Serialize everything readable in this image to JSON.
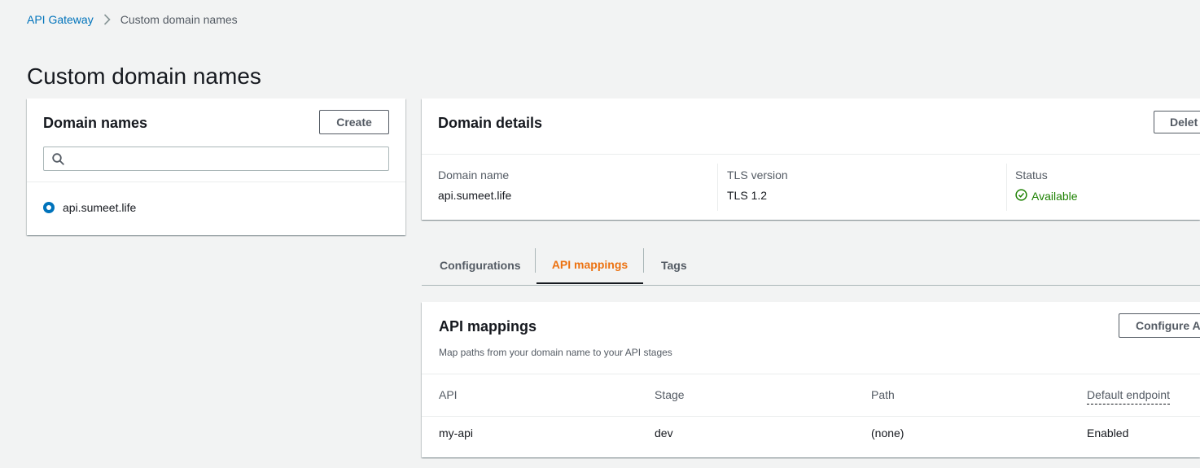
{
  "breadcrumb": {
    "root": "API Gateway",
    "current": "Custom domain names"
  },
  "page_title": "Custom domain names",
  "left_panel": {
    "title": "Domain names",
    "create_label": "Create",
    "search": {
      "value": "",
      "placeholder": ""
    },
    "items": [
      {
        "label": "api.sumeet.life",
        "selected": true
      }
    ]
  },
  "details": {
    "title": "Domain details",
    "delete_label": "Delet",
    "fields": {
      "domain_name_label": "Domain name",
      "domain_name_value": "api.sumeet.life",
      "tls_label": "TLS version",
      "tls_value": "TLS 1.2",
      "status_label": "Status",
      "status_value": "Available"
    }
  },
  "tabs": [
    {
      "label": "Configurations",
      "active": false
    },
    {
      "label": "API mappings",
      "active": true
    },
    {
      "label": "Tags",
      "active": false
    }
  ],
  "mappings": {
    "title": "API mappings",
    "description": "Map paths from your domain name to your API stages",
    "configure_label": "Configure A",
    "columns": [
      "API",
      "Stage",
      "Path",
      "Default endpoint"
    ],
    "rows": [
      {
        "api": "my-api",
        "stage": "dev",
        "path": "(none)",
        "default_endpoint": "Enabled"
      }
    ]
  },
  "colors": {
    "link": "#0073bb",
    "active_tab": "#ec7211",
    "success": "#1d8102",
    "background": "#f2f3f3"
  },
  "icons": [
    "chevron-right-icon",
    "search-icon",
    "check-circle-icon"
  ]
}
